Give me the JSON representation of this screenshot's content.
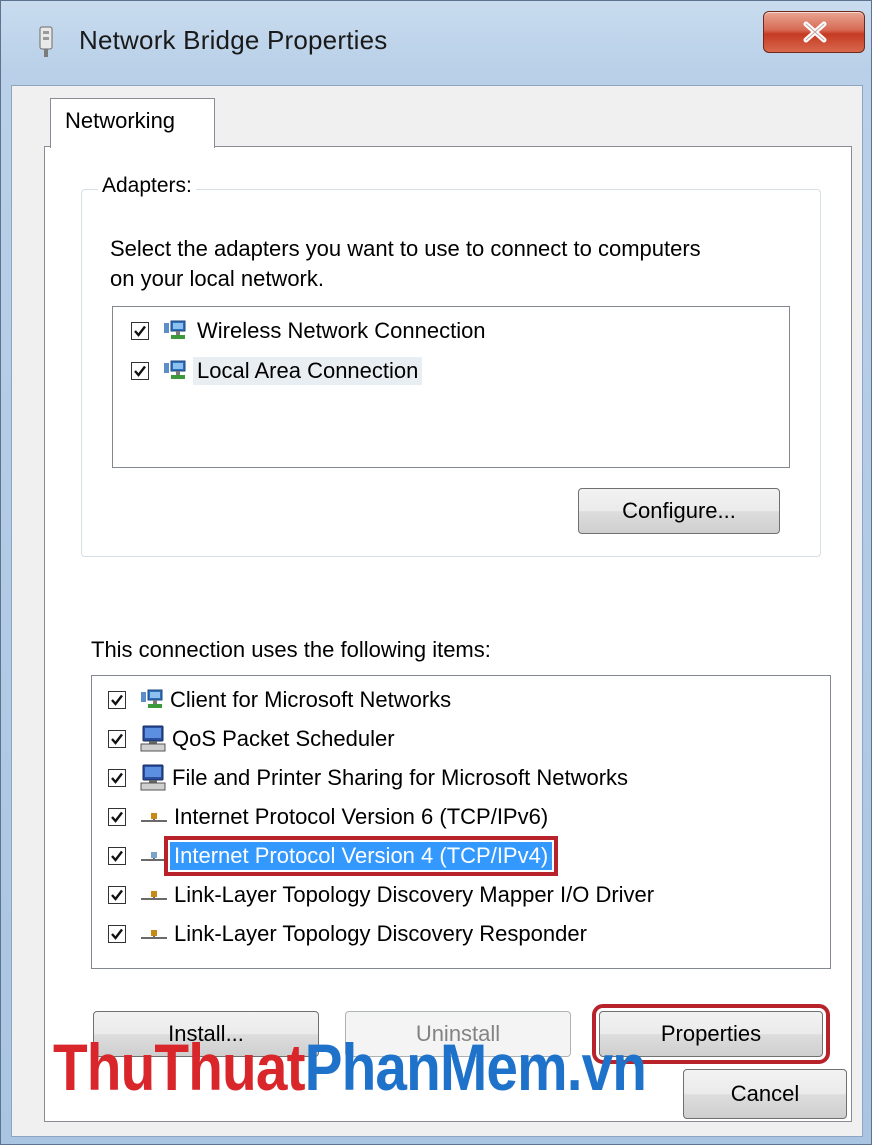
{
  "window": {
    "title": "Network Bridge Properties",
    "close_glyph": "X"
  },
  "tabs": [
    {
      "label": "Networking",
      "active": true
    }
  ],
  "adapters": {
    "group_label": "Adapters:",
    "description_line1": "Select the adapters you want to use to connect to computers",
    "description_line2": "on your local network.",
    "items": [
      {
        "label": "Wireless Network Connection",
        "checked": true,
        "icon": "network-adapter-icon"
      },
      {
        "label": "Local Area Connection",
        "checked": true,
        "icon": "network-adapter-icon",
        "selected": true
      }
    ],
    "configure_label": "Configure..."
  },
  "items_section": {
    "label": "This connection uses the following items:",
    "items": [
      {
        "label": "Client for Microsoft Networks",
        "checked": true,
        "icon": "network-client-icon"
      },
      {
        "label": "QoS Packet Scheduler",
        "checked": true,
        "icon": "computer-service-icon"
      },
      {
        "label": "File and Printer Sharing for Microsoft Networks",
        "checked": true,
        "icon": "computer-service-icon"
      },
      {
        "label": "Internet Protocol Version 6 (TCP/IPv6)",
        "checked": true,
        "icon": "protocol-icon"
      },
      {
        "label": "Internet Protocol Version 4 (TCP/IPv4)",
        "checked": true,
        "icon": "protocol-icon",
        "selected": true
      },
      {
        "label": "Link-Layer Topology Discovery Mapper I/O Driver",
        "checked": true,
        "icon": "protocol-icon"
      },
      {
        "label": "Link-Layer Topology Discovery Responder",
        "checked": true,
        "icon": "protocol-icon"
      }
    ]
  },
  "buttons": {
    "install": "Install...",
    "uninstall": "Uninstall",
    "properties": "Properties",
    "cancel": "Cancel"
  },
  "watermark": {
    "part1": "ThuThuat",
    "part2": "PhanMem",
    "part3": ".vn"
  },
  "colors": {
    "selection": "#3399ff",
    "highlight_box": "#b8232b",
    "watermark_red": "#d8262b",
    "watermark_blue": "#1f72c9"
  }
}
